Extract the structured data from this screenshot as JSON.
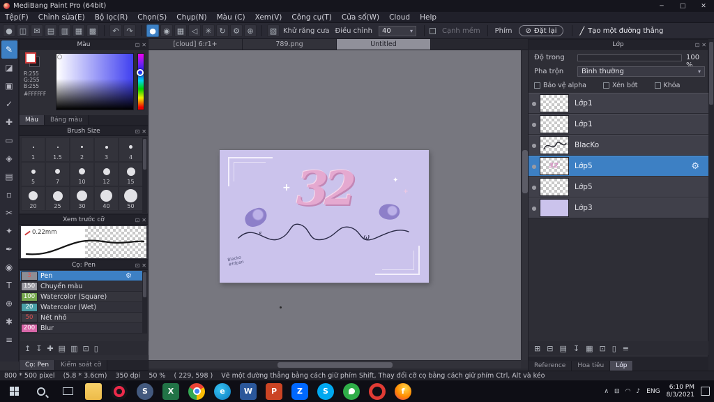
{
  "titlebar": {
    "title": "MediBang Paint Pro (64bit)"
  },
  "icons": {
    "minimize": "─",
    "maximize": "□",
    "close": "✕",
    "popout": "⊡",
    "undo": "↶",
    "redo": "↷",
    "dropdown": "▾",
    "gear": "⚙",
    "slash": "╱",
    "no_entry": "⊘",
    "visibility": "●",
    "plus": "+",
    "sparkle": "✦",
    "omega": "ω",
    "curl": "ε"
  },
  "menu": {
    "items": [
      "Tệp(F)",
      "Chỉnh sửa(E)",
      "Bộ lọc(R)",
      "Chọn(S)",
      "Chụp(N)",
      "Màu (C)",
      "Xem(V)",
      "Công cụ(T)",
      "Cửa sổ(W)",
      "Cloud",
      "Help"
    ]
  },
  "toolbar": {
    "left_icons": [
      "●",
      "◫",
      "✉",
      "▤",
      "▥",
      "▦",
      "▩"
    ],
    "selected_icon": "●",
    "mid_icons": [
      "◉",
      "▦",
      "◁",
      "✳",
      "↻",
      "⚙",
      "⊕"
    ],
    "aa_icon": "▧",
    "aa_label": "Khử răng cưa",
    "adjust_label": "Điều chỉnh",
    "adjust_value": "40",
    "soft_label": "Cạnh mềm",
    "key_label": "Phím",
    "reset_label": "Đặt lại",
    "tool_label": "Tạo một đường thẳng"
  },
  "tools": {
    "items": [
      "✎",
      "◪",
      "▣",
      "✓",
      "✚",
      "▭",
      "◈",
      "▤",
      "▫",
      "✂",
      "✦",
      "✒",
      "◉",
      "T",
      "⊕",
      "✱",
      "≡"
    ]
  },
  "color_panel": {
    "title": "Màu",
    "r_value": "R:255",
    "g_value": "G:255",
    "b_value": "B:255",
    "hex_value": "#FFFFFF",
    "tabs": [
      "Màu",
      "Bảng màu"
    ]
  },
  "brush_size_panel": {
    "title": "Brush Size",
    "sizes": [
      "1",
      "1.5",
      "2",
      "3",
      "4",
      "5",
      "7",
      "10",
      "12",
      "15",
      "20",
      "25",
      "30",
      "40",
      "50"
    ]
  },
  "preview_panel": {
    "title": "Xem trước cỡ",
    "size_label": "0.22mm"
  },
  "brush_panel": {
    "title": "Cọ: Pen",
    "brushes": [
      {
        "size": "3",
        "name": "Pen",
        "chip": "#8d8d95"
      },
      {
        "size": "150",
        "name": "Chuyển màu",
        "chip": "#9a9aa2"
      },
      {
        "size": "100",
        "name": "Watercolor (Square)",
        "chip": "#76a84e"
      },
      {
        "size": "20",
        "name": "Watercolor (Wet)",
        "chip": "#4aa0a8"
      },
      {
        "size": "50",
        "name": "Nét nhỏ",
        "chip": "#3a3a42"
      },
      {
        "size": "200",
        "name": "Blur",
        "chip": "#d867a8"
      }
    ],
    "footer_icons": [
      "↥",
      "↧",
      "✚",
      "▤",
      "▥",
      "⊡",
      "▯"
    ],
    "tabs": [
      "Cọ: Pen",
      "Kiểm soát cỡ"
    ]
  },
  "canvas": {
    "tabs": [
      "[cloud] 6:r1+",
      "789.png",
      "Untitled"
    ],
    "number": "32",
    "signature_line1": "Blacko",
    "signature_line2": "#hfpan"
  },
  "layers_panel": {
    "title": "Lớp",
    "opacity_label": "Độ trong",
    "opacity_value": "100 %",
    "blend_label": "Pha trộn",
    "blend_value": "Bình thường",
    "alpha_label": "Bảo vệ alpha",
    "clip_label": "Xén bớt",
    "lock_label": "Khóa",
    "layers": [
      {
        "name": "Lớp1"
      },
      {
        "name": "Lớp1"
      },
      {
        "name": "BlacKo"
      },
      {
        "name": "Lớp5"
      },
      {
        "name": "Lớp5"
      },
      {
        "name": "Lớp3"
      }
    ],
    "footer_icons": [
      "⊞",
      "⊟",
      "▤",
      "↧",
      "▦",
      "⊡",
      "▯",
      "≡"
    ],
    "tabs": [
      "Reference",
      "Hoa tiêu",
      "Lớp"
    ]
  },
  "status": {
    "size": "800 * 500 pixel",
    "cm": "(5.8 * 3.6cm)",
    "dpi": "350 dpi",
    "zoom": "50 %",
    "coords": "( 229, 598 )",
    "hint": "Vẽ một đường thẳng bằng cách giữ phím Shift, Thay đổi cỡ cọ bằng cách giữ phím Ctrl, Alt và kéo"
  },
  "taskbar": {
    "apps": [
      {
        "letter": ""
      },
      {
        "letter": ""
      },
      {
        "letter": "S"
      },
      {
        "letter": "X"
      },
      {
        "letter": ""
      },
      {
        "letter": "e"
      },
      {
        "letter": "W"
      },
      {
        "letter": "P"
      },
      {
        "letter": "Z"
      },
      {
        "letter": "S"
      },
      {
        "letter": ""
      },
      {
        "letter": ""
      },
      {
        "letter": "f"
      }
    ],
    "tray_icons": [
      "∧",
      "⊟",
      "◠",
      "♪"
    ],
    "language": "ENG",
    "time": "6:10 PM",
    "date": "8/3/2021"
  },
  "colors": {
    "accent": "#3d80c4",
    "canvas_bg": "#cbc3ec",
    "number_pink": "#e5a9d0"
  }
}
